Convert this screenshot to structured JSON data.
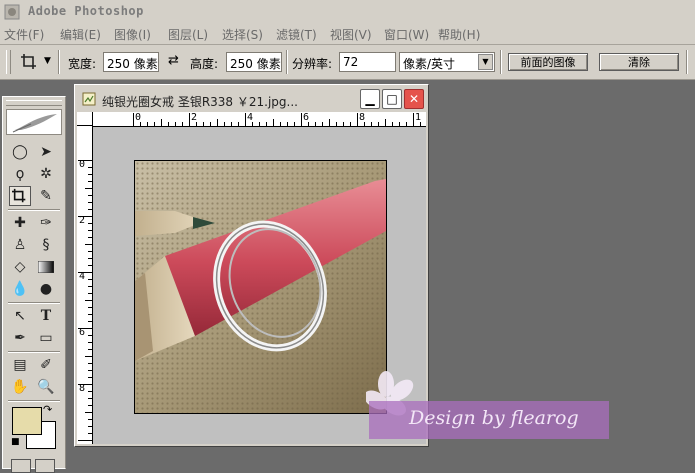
{
  "app": {
    "title": "Adobe Photoshop"
  },
  "menu": [
    "文件(F)",
    "编辑(E)",
    "图像(I)",
    "图层(L)",
    "选择(S)",
    "滤镜(T)",
    "视图(V)",
    "窗口(W)",
    "帮助(H)"
  ],
  "options": {
    "width_label": "宽度:",
    "width_value": "250 像素",
    "swap_symbol": "⇄",
    "height_label": "高度:",
    "height_value": "250 像素",
    "resolution_label": "分辨率:",
    "resolution_value": "72",
    "unit_value": "像素/英寸",
    "front_image_button": "前面的图像",
    "clear_button": "清除"
  },
  "document": {
    "title": "纯银光圈女戒 圣银R338 ￥21.jpg...",
    "ruler_top": [
      "0",
      "2",
      "4",
      "6",
      "8",
      "1"
    ],
    "ruler_left": [
      "0",
      "2",
      "4",
      "6",
      "8"
    ]
  },
  "watermark": {
    "text": "Design by flearog"
  },
  "colors": {
    "foreground": "#e6dcaa",
    "background": "#ffffff",
    "watermark": "#a66ebe"
  }
}
